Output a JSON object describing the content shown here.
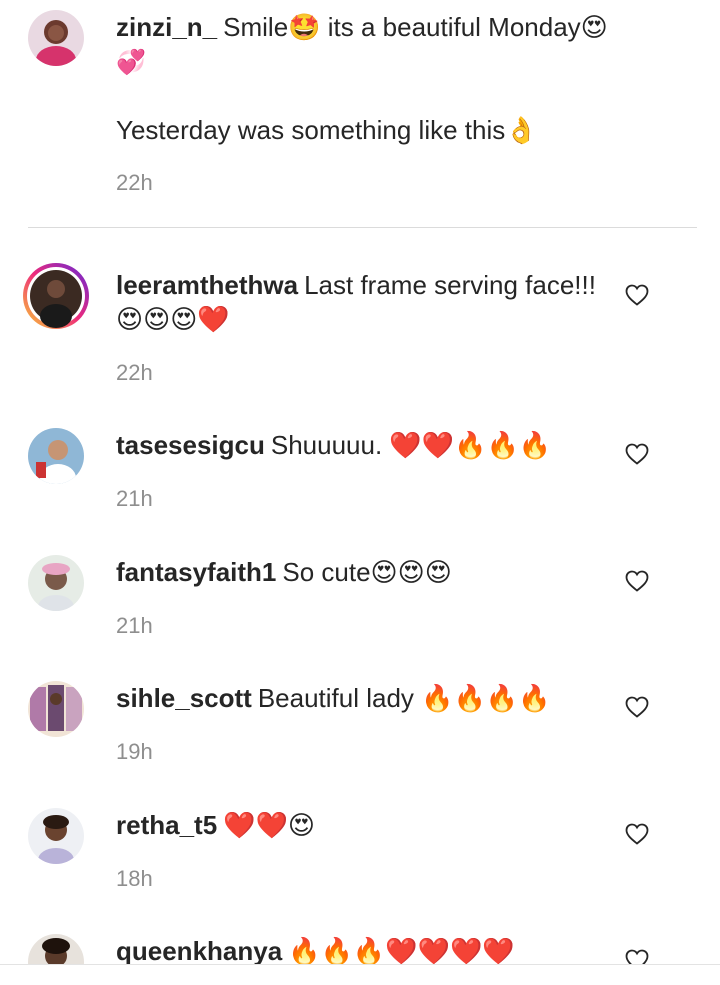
{
  "caption": {
    "username": "zinzi_n_",
    "text_line1": "Smile🤩 its a beautiful Monday😍",
    "text_line2": "💞",
    "text_line3": "Yesterday was something like this👌",
    "time": "22h"
  },
  "comments": [
    {
      "username": "leeramthethwa",
      "text": "Last frame serving face!!!😍😍😍❤️",
      "time": "22h"
    },
    {
      "username": "tasesesigcu",
      "text": "Shuuuuu. ❤️❤️🔥🔥🔥",
      "time": "21h"
    },
    {
      "username": "fantasyfaith1",
      "text": "So cute😍😍😍",
      "time": "21h"
    },
    {
      "username": "sihle_scott",
      "text": "Beautiful lady 🔥🔥🔥🔥",
      "time": "19h"
    },
    {
      "username": "retha_t5",
      "text": "❤️❤️😍",
      "time": "18h"
    },
    {
      "username": "queenkhanya",
      "text": "🔥🔥🔥❤️❤️❤️❤️",
      "time": ""
    }
  ],
  "colors": {
    "text": "#262626",
    "muted": "#8e8e8e",
    "divider": "#dbdbdb",
    "story_ring_start": "#f9ce34",
    "story_ring_end": "#ee2a7b"
  },
  "icons": {
    "like": "heart-outline-icon"
  }
}
